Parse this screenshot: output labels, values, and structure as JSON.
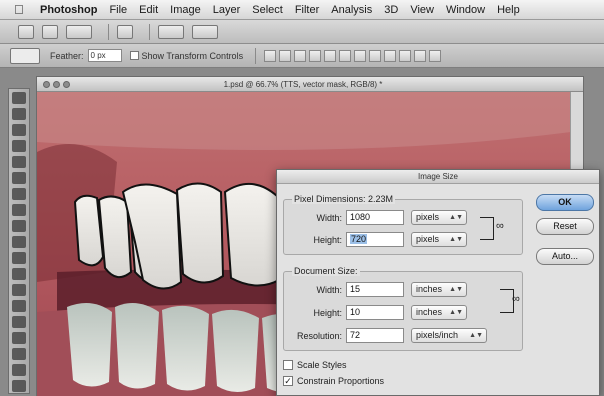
{
  "menubar": {
    "app": "Photoshop",
    "items": [
      "File",
      "Edit",
      "Image",
      "Layer",
      "Select",
      "Filter",
      "Analysis",
      "3D",
      "View",
      "Window",
      "Help"
    ]
  },
  "options": {
    "feather_label": "Feather:",
    "feather_value": "0 px",
    "transform_label": "Show Transform Controls"
  },
  "document": {
    "title": "1.psd @ 66.7% (TTS, vector mask, RGB/8) *"
  },
  "dialog": {
    "title": "Image Size",
    "pixel_dimensions": {
      "label": "Pixel Dimensions: 2.23M",
      "width_label": "Width:",
      "width_value": "1080",
      "width_unit": "pixels",
      "height_label": "Height:",
      "height_value": "720",
      "height_unit": "pixels"
    },
    "document_size": {
      "label": "Document Size:",
      "width_label": "Width:",
      "width_value": "15",
      "width_unit": "inches",
      "height_label": "Height:",
      "height_value": "10",
      "height_unit": "inches",
      "resolution_label": "Resolution:",
      "resolution_value": "72",
      "resolution_unit": "pixels/inch"
    },
    "scale_styles": "Scale Styles",
    "constrain": "Constrain Proportions",
    "constrain_checked": true,
    "buttons": {
      "ok": "OK",
      "reset": "Reset",
      "auto": "Auto..."
    }
  }
}
